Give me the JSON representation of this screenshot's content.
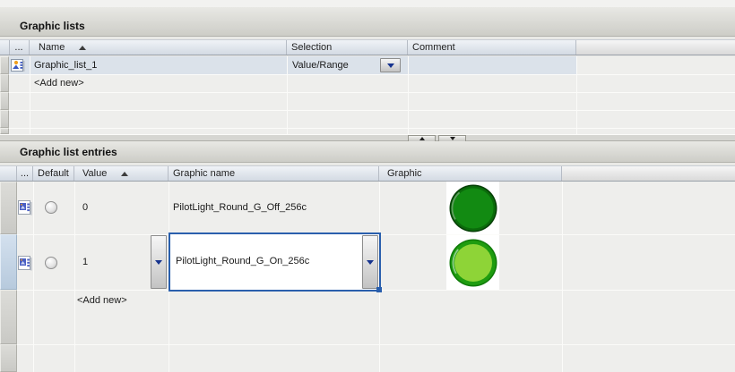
{
  "graphic_lists": {
    "title": "Graphic lists",
    "header": {
      "dots": "...",
      "name": "Name",
      "selection": "Selection",
      "comment": "Comment"
    },
    "rows": [
      {
        "icon": "graphic-list-icon",
        "name": "Graphic_list_1",
        "selection": "Value/Range"
      },
      {
        "name": "<Add new>"
      }
    ]
  },
  "splitter": {
    "up_icon": "collapse-up-arrow",
    "down_icon": "expand-down-arrow"
  },
  "graphic_list_entries": {
    "title": "Graphic list entries",
    "header": {
      "dots": "...",
      "default": "Default",
      "value": "Value",
      "graphic_name": "Graphic name",
      "graphic": "Graphic"
    },
    "rows": [
      {
        "icon": "graphic-entry-icon",
        "default_selected": false,
        "value": "0",
        "graphic_name": "PilotLight_Round_G_Off_256c",
        "graphic": "pilot-light-green-off"
      },
      {
        "icon": "graphic-entry-icon",
        "default_selected": false,
        "value": "1",
        "graphic_name": "PilotLight_Round_G_On_256c",
        "graphic": "pilot-light-green-on"
      }
    ],
    "add_new": "<Add new>"
  },
  "colors": {
    "pilot_off_edge": "#063f06",
    "pilot_off_ring": "#0b6b0b",
    "pilot_off_fill": "#128a12",
    "pilot_on_edge": "#0f7a08",
    "pilot_on_ring": "#1f9c10",
    "pilot_on_fill": "#8ed437",
    "selection_highlight": "#dbe2ea",
    "edit_border": "#2a5fad",
    "dropdown_arrow": "#16338e"
  }
}
